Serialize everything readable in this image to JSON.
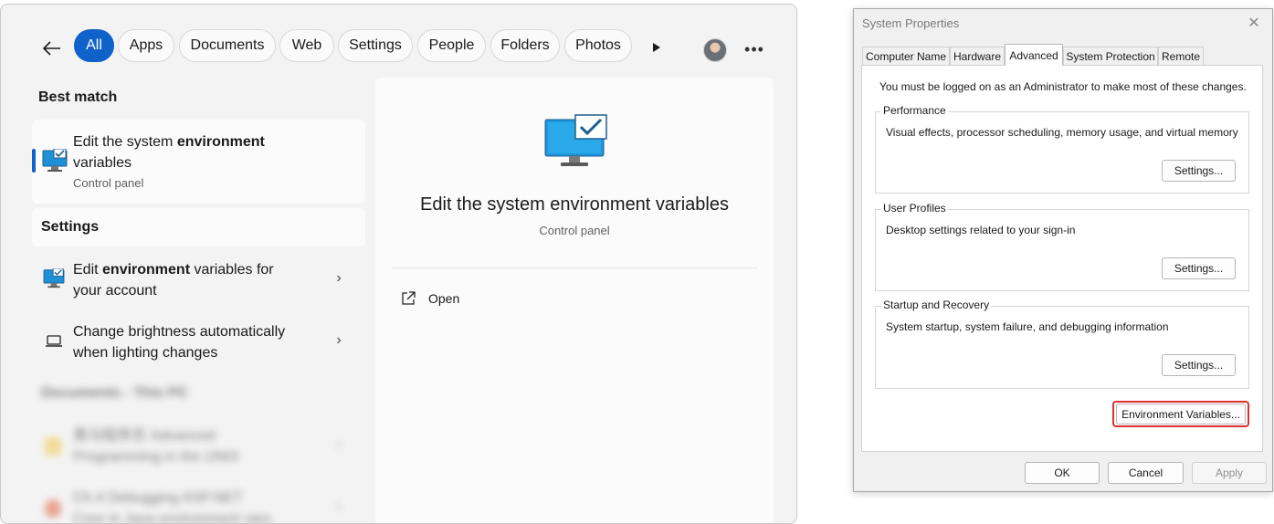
{
  "search": {
    "filters": [
      "All",
      "Apps",
      "Documents",
      "Web",
      "Settings",
      "People",
      "Folders",
      "Photos"
    ],
    "active_filter": "All",
    "best_match_label": "Best match",
    "best_match": {
      "title_pre": "Edit the system ",
      "title_bold": "environment",
      "title_post": "variables",
      "subtitle": "Control panel"
    },
    "settings_label": "Settings",
    "settings_items": [
      {
        "line1_pre": "Edit ",
        "line1_bold": "environment",
        "line1_post": " variables for",
        "line2": "your account"
      },
      {
        "line1_pre": "Change brightness automatically",
        "line1_bold": "",
        "line1_post": "",
        "line2": "when lighting changes"
      }
    ],
    "documents_label": "Documents - This PC",
    "documents_items": [
      {
        "line1": "黑马程序员 Advanced",
        "line2": "Programming in the UNIX"
      },
      {
        "line1": "Ch.4 Debugging ASP.NET",
        "line2": "Core in Java environment vars"
      }
    ],
    "preview": {
      "title": "Edit the system environment variables",
      "subtitle": "Control panel",
      "open_label": "Open"
    }
  },
  "dialog": {
    "title": "System Properties",
    "tabs": [
      "Computer Name",
      "Hardware",
      "Advanced",
      "System Protection",
      "Remote"
    ],
    "active_tab": "Advanced",
    "admin_note": "You must be logged on as an Administrator to make most of these changes.",
    "groups": [
      {
        "label": "Performance",
        "desc": "Visual effects, processor scheduling, memory usage, and virtual memory",
        "button": "Settings..."
      },
      {
        "label": "User Profiles",
        "desc": "Desktop settings related to your sign-in",
        "button": "Settings..."
      },
      {
        "label": "Startup and Recovery",
        "desc": "System startup, system failure, and debugging information",
        "button": "Settings..."
      }
    ],
    "env_button": "Environment Variables...",
    "ok": "OK",
    "cancel": "Cancel",
    "apply": "Apply",
    "highlight_color": "#e03030"
  },
  "colors": {
    "accent": "#0f62c9"
  }
}
